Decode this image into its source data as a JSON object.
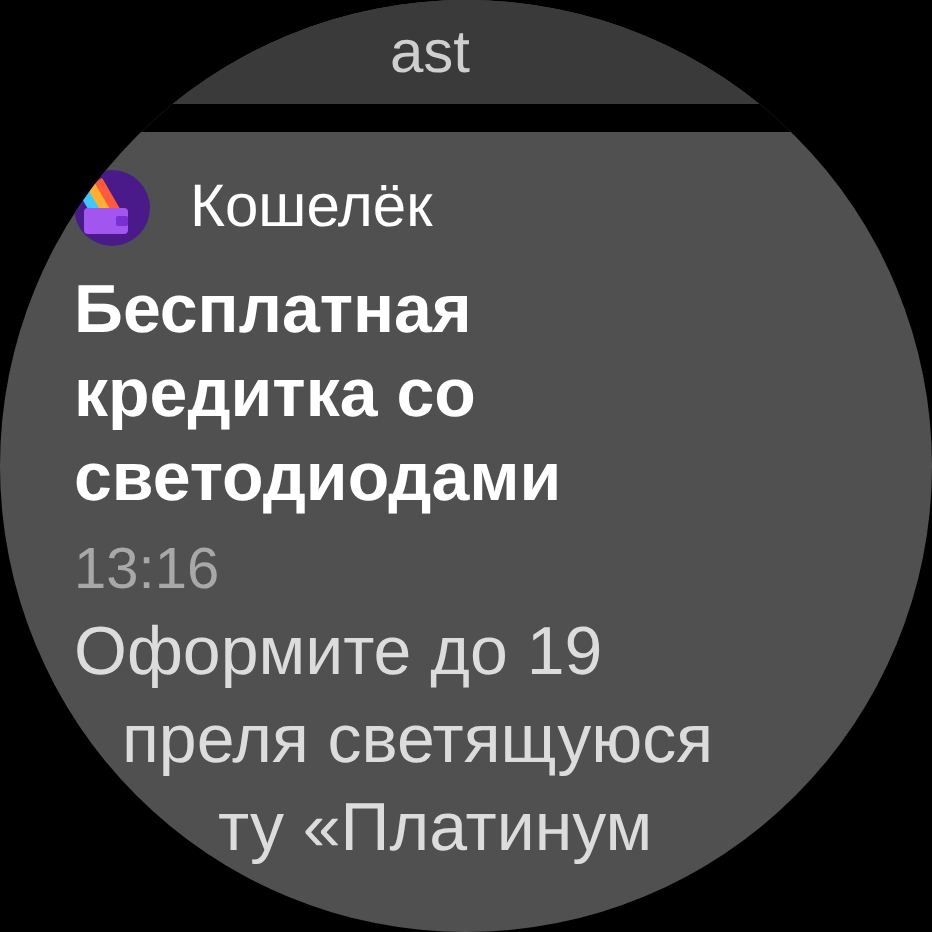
{
  "previous_notification": {
    "text_fragment": "ast"
  },
  "notification": {
    "app_name": "Кошелёк",
    "title_lines": [
      "Бесплатная",
      "кредитка со",
      "светодиодами"
    ],
    "time": "13:16",
    "body_lines": [
      "Оформите до 19",
      "преля светящуюся",
      "ту «Платинум"
    ]
  }
}
